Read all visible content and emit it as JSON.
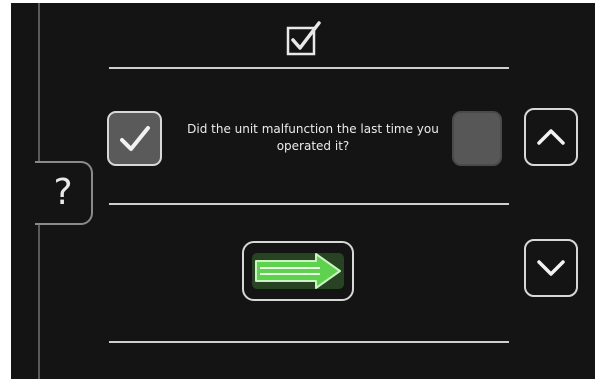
{
  "question": {
    "text": "Did the unit malfunction the last time you operated it?"
  },
  "help": {
    "label": "?"
  },
  "icons": {
    "header": "checkbox-checked-icon",
    "yes": "checkmark-icon",
    "up": "chevron-up-icon",
    "down": "chevron-down-icon",
    "next": "arrow-right-icon"
  },
  "colors": {
    "background": "#141414",
    "accent_green": "#5ed14f",
    "border_light": "#d8d8d8",
    "checkbox_fill": "#5a5a5a"
  }
}
